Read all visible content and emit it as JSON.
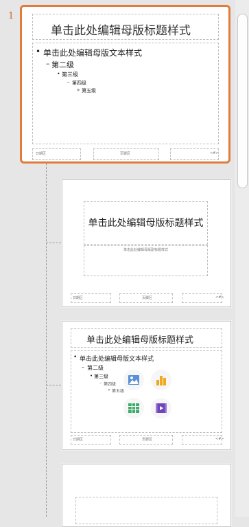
{
  "panel": {
    "master": {
      "number": "1",
      "title": "单击此处编辑母版标题样式",
      "body": [
        "单击此处编辑母版文本样式",
        "第二级",
        "第三级",
        "第四级",
        "第五级"
      ],
      "footer": [
        "日期区",
        "页脚区",
        "<#>"
      ]
    },
    "layouts": [
      {
        "title": "单击此处编辑母版标题样式",
        "subtitle": "单击此处编辑母版副标题样式",
        "footer": [
          "日期区",
          "页脚区",
          "<#>"
        ]
      },
      {
        "title": "单击此处编辑母版标题样式",
        "body": [
          "单击此处编辑母版文本样式",
          "第二级",
          "第三级",
          "第四级",
          "第五级"
        ],
        "footer": [
          "日期区",
          "页脚区",
          "<#>"
        ],
        "icons": [
          "picture-icon",
          "chart-icon",
          "table-icon",
          "video-icon"
        ]
      },
      {}
    ]
  },
  "colors": {
    "selection": "#e07b3c",
    "number": "#c8642a"
  }
}
